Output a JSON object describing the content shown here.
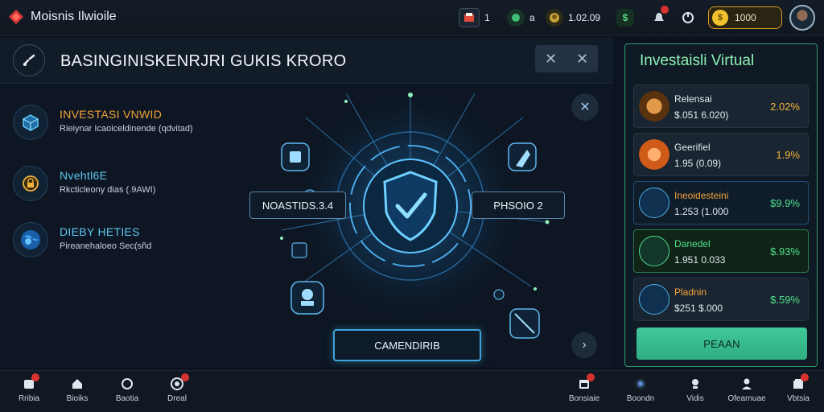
{
  "app": {
    "title": "Moisnis Ilwioile"
  },
  "topbar": {
    "chip1_value": "1",
    "chip2_value": "a",
    "chip3_value": "1.02.09",
    "coins": "1000"
  },
  "main": {
    "title": "BASINGINISKENRJRI GUKIS KRORO",
    "categories": [
      {
        "title": "INVESTASI VNWID",
        "subtitle": "Rieiynar Icaoiceldinende (qdvitad)",
        "color": "#f2a43a"
      },
      {
        "title": "Nvehtl6E",
        "subtitle": "Rkcticleony dias (.9AWI)",
        "color": "#5fc8f2"
      },
      {
        "title": "DIEBY HETIES",
        "subtitle": "Pireanehaloeo Sec(sñd",
        "color": "#5fc8f2"
      }
    ],
    "left_label": "NOASTIDS.3.4",
    "right_label": "PHSOIO 2",
    "cta_label": "CAMENDIRIB"
  },
  "side": {
    "title": "Investaisli Virtual",
    "items": [
      {
        "name": "Relensai",
        "price": "$.051 6.020)",
        "change": "2.02%",
        "name_color": "#e1e8ef",
        "change_color": "#f0b43a"
      },
      {
        "name": "Geerifiel",
        "price": "1.95 (0.09)",
        "change": "1.9%",
        "name_color": "#e1e8ef",
        "change_color": "#f0b43a"
      },
      {
        "name": "Ineoidesteini",
        "price": "1.253 (1.000",
        "change": "$9.9%",
        "name_color": "#f2a43a",
        "change_color": "#4fe08a"
      },
      {
        "name": "Danedel",
        "price": "1.951 0.033",
        "change": "$.93%",
        "name_color": "#4fe08a",
        "change_color": "#4fe08a"
      },
      {
        "name": "Pladnin",
        "price": "$251 $.000",
        "change": "$.59%",
        "name_color": "#f2a43a",
        "change_color": "#4fe08a"
      }
    ],
    "plan_label": "PEAAN"
  },
  "bottom_nav": [
    {
      "label": "Rribia",
      "icon": "inbox-icon"
    },
    {
      "label": "Bioiks",
      "icon": "home-icon"
    },
    {
      "label": "Baotia",
      "icon": "chat-icon"
    },
    {
      "label": "Dreal",
      "icon": "target-icon"
    },
    {
      "label": "Bonsiaie",
      "icon": "calendar-icon"
    },
    {
      "label": "Boondn",
      "icon": "coin-icon"
    },
    {
      "label": "Vidis",
      "icon": "trophy-icon"
    },
    {
      "label": "Ofearnuae",
      "icon": "user-icon"
    },
    {
      "label": "Vbtsia",
      "icon": "shop-icon"
    }
  ],
  "colors": {
    "accent_blue": "#3fa4d8",
    "accent_green": "#2fae82",
    "gold": "#d89b22"
  }
}
